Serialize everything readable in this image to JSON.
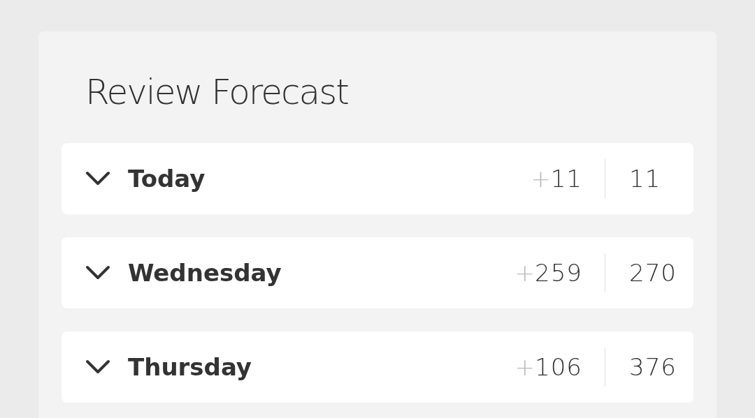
{
  "title": "Review Forecast",
  "days": [
    {
      "label": "Today",
      "sign": "+",
      "new": "11",
      "total": "11",
      "expanded": false
    },
    {
      "label": "Wednesday",
      "sign": "+",
      "new": "259",
      "total": "270",
      "expanded": false
    },
    {
      "label": "Thursday",
      "sign": "+",
      "new": "106",
      "total": "376",
      "expanded": false
    }
  ]
}
